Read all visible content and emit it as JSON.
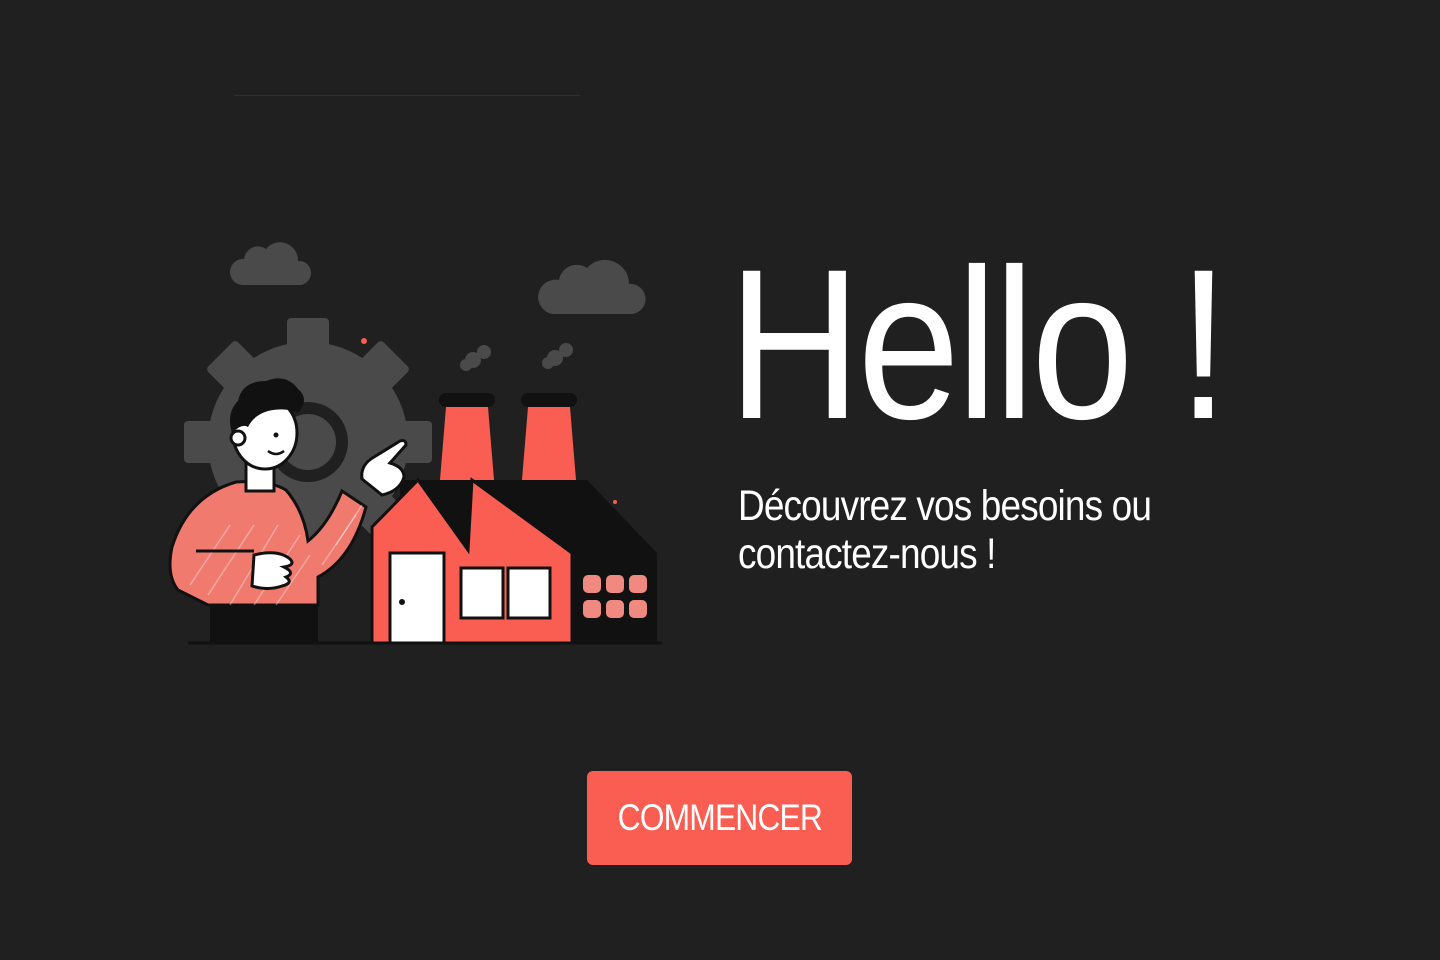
{
  "hero": {
    "title": "Hello !",
    "subtitle": "Découvrez vos besoins ou contactez-nous !"
  },
  "cta": {
    "label": "COMMENCER"
  },
  "illustration": {
    "icons": [
      "cloud-icon",
      "gear-icon",
      "factory-icon",
      "smoke-icon"
    ]
  },
  "colors": {
    "background": "#202020",
    "accent": "#fa5e52",
    "text": "#ffffff",
    "decoration_gray": "#4a4a4a"
  }
}
